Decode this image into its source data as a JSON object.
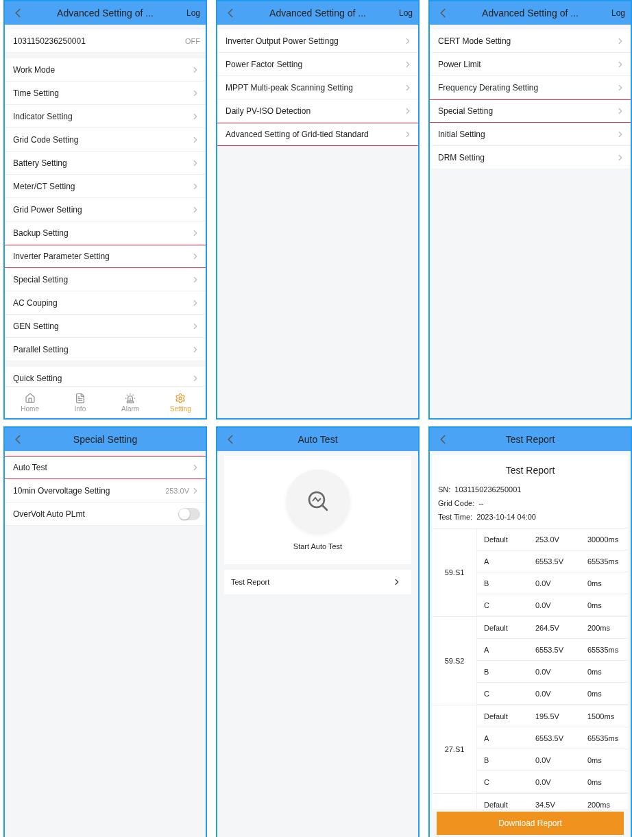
{
  "screens": [
    {
      "kind": "menu",
      "title": "Advanced Setting of ...",
      "action": "Log",
      "groups": [
        {
          "items": [
            {
              "kind": "status",
              "label": "1031150236250001",
              "value": "OFF",
              "highlighted": false
            }
          ]
        },
        {
          "items": [
            {
              "kind": "link",
              "label": "Work Mode",
              "highlighted": false
            },
            {
              "kind": "link",
              "label": "Time Setting",
              "highlighted": false
            },
            {
              "kind": "link",
              "label": "Indicator Setting",
              "highlighted": false
            },
            {
              "kind": "link",
              "label": "Grid Code Setting",
              "highlighted": false
            },
            {
              "kind": "link",
              "label": "Battery Setting",
              "highlighted": false
            },
            {
              "kind": "link",
              "label": "Meter/CT Setting",
              "highlighted": false
            },
            {
              "kind": "link",
              "label": "Grid Power Setting",
              "highlighted": false
            },
            {
              "kind": "link",
              "label": "Backup Setting",
              "highlighted": false
            },
            {
              "kind": "link",
              "label": "Inverter Parameter Setting",
              "highlighted": true
            },
            {
              "kind": "link",
              "label": "Special Setting",
              "highlighted": false
            },
            {
              "kind": "link",
              "label": "AC Couping",
              "highlighted": false
            },
            {
              "kind": "link",
              "label": "GEN Setting",
              "highlighted": false
            },
            {
              "kind": "link",
              "label": "Parallel Setting",
              "highlighted": false
            }
          ]
        },
        {
          "items": [
            {
              "kind": "link",
              "label": "Quick Setting",
              "highlighted": false
            }
          ]
        }
      ],
      "tabs": [
        {
          "label": "Home",
          "selected": false
        },
        {
          "label": "Info",
          "selected": false
        },
        {
          "label": "Alarm",
          "selected": false
        },
        {
          "label": "Setting",
          "selected": true
        }
      ]
    },
    {
      "kind": "menu",
      "title": "Advanced Setting of ...",
      "action": "Log",
      "groups": [
        {
          "items": [
            {
              "kind": "link",
              "label": "Inverter Output Power Settingg",
              "highlighted": false
            },
            {
              "kind": "link",
              "label": "Power Factor Setting",
              "highlighted": false
            },
            {
              "kind": "link",
              "label": "MPPT Multi-peak Scanning Setting",
              "highlighted": false
            },
            {
              "kind": "link",
              "label": "Daily PV-ISO Detection",
              "highlighted": false
            },
            {
              "kind": "link",
              "label": "Advanced Setting of Grid-tied Standard",
              "highlighted": true
            }
          ]
        }
      ]
    },
    {
      "kind": "menu",
      "title": "Advanced Setting of ...",
      "action": "Log",
      "groups": [
        {
          "items": [
            {
              "kind": "link",
              "label": "CERT Mode Setting",
              "highlighted": false
            },
            {
              "kind": "link",
              "label": "Power Limit",
              "highlighted": false
            },
            {
              "kind": "link",
              "label": "Frequency Derating Setting",
              "highlighted": false
            },
            {
              "kind": "link",
              "label": "Special Setting",
              "highlighted": true
            },
            {
              "kind": "link",
              "label": "Initial Setting",
              "highlighted": false
            },
            {
              "kind": "link",
              "label": "DRM Setting",
              "highlighted": false
            }
          ]
        }
      ]
    },
    {
      "kind": "menu",
      "title": "Special Setting",
      "groups": [
        {
          "items": [
            {
              "kind": "link",
              "label": "Auto Test",
              "highlighted": true
            },
            {
              "kind": "link",
              "label": "10min Overvoltage Setting",
              "value": "253.0V",
              "highlighted": false
            },
            {
              "kind": "toggle",
              "label": "OverVolt Auto PLmt",
              "on": false,
              "highlighted": false
            }
          ]
        }
      ]
    },
    {
      "kind": "autotest",
      "title": "Auto Test",
      "start_label": "Start Auto Test",
      "link": "Test Report"
    },
    {
      "kind": "report",
      "title": "Test Report",
      "heading": "Test Report",
      "info": [
        {
          "label": "SN:",
          "value": "1031150236250001"
        },
        {
          "label": "Grid Code:",
          "value": "--"
        },
        {
          "label": "Test Time:",
          "value": "2023-10-14 04:00"
        }
      ],
      "groups": [
        {
          "name": "59.S1",
          "rows": [
            [
              "Default",
              "253.0V",
              "30000ms"
            ],
            [
              "A",
              "6553.5V",
              "65535ms"
            ],
            [
              "B",
              "0.0V",
              "0ms"
            ],
            [
              "C",
              "0.0V",
              "0ms"
            ]
          ]
        },
        {
          "name": "59.S2",
          "rows": [
            [
              "Default",
              "264.5V",
              "200ms"
            ],
            [
              "A",
              "6553.5V",
              "65535ms"
            ],
            [
              "B",
              "0.0V",
              "0ms"
            ],
            [
              "C",
              "0.0V",
              "0ms"
            ]
          ]
        },
        {
          "name": "27.S1",
          "rows": [
            [
              "Default",
              "195.5V",
              "1500ms"
            ],
            [
              "A",
              "6553.5V",
              "65535ms"
            ],
            [
              "B",
              "0.0V",
              "0ms"
            ],
            [
              "C",
              "0.0V",
              "0ms"
            ]
          ]
        },
        {
          "rows": [
            [
              "Default",
              "34.5V",
              "200ms"
            ]
          ]
        }
      ],
      "button": "Download Report"
    }
  ]
}
